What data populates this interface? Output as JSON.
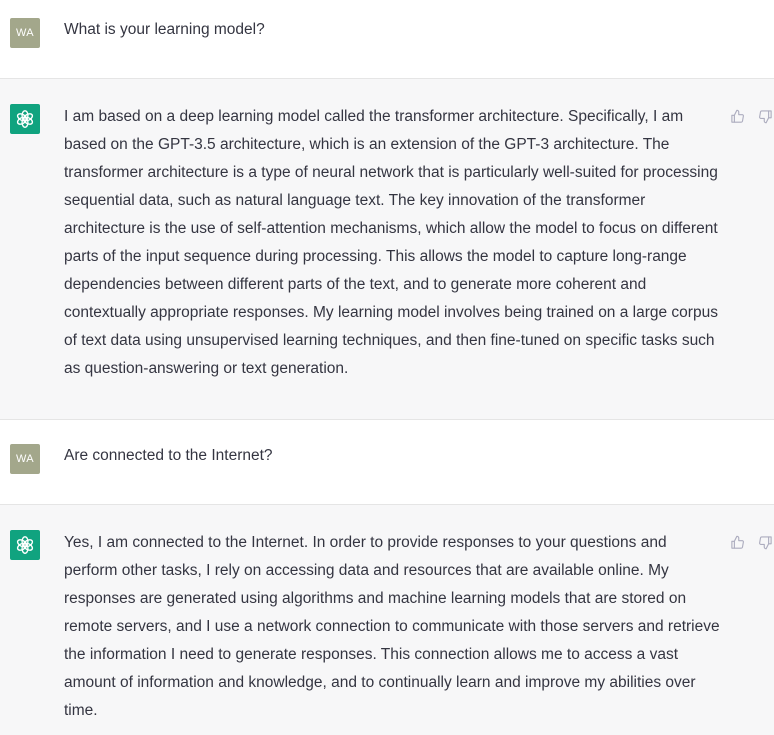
{
  "conversation": {
    "messages": [
      {
        "role": "user",
        "avatar_text": "WA",
        "text": "What is your learning model?"
      },
      {
        "role": "assistant",
        "avatar_icon": "openai-logo-icon",
        "text": "I am based on a deep learning model called the transformer architecture. Specifically, I am based on the GPT-3.5 architecture, which is an extension of the GPT-3 architecture. The transformer architecture is a type of neural network that is particularly well-suited for processing sequential data, such as natural language text. The key innovation of the transformer architecture is the use of self-attention mechanisms, which allow the model to focus on different parts of the input sequence during processing. This allows the model to capture long-range dependencies between different parts of the text, and to generate more coherent and contextually appropriate responses. My learning model involves being trained on a large corpus of text data using unsupervised learning techniques, and then fine-tuned on specific tasks such as question-answering or text generation."
      },
      {
        "role": "user",
        "avatar_text": "WA",
        "text": "Are connected to the Internet?"
      },
      {
        "role": "assistant",
        "avatar_icon": "openai-logo-icon",
        "text": "Yes, I am connected to the Internet. In order to provide responses to your questions and perform other tasks, I rely on accessing data and resources that are available online. My responses are generated using algorithms and machine learning models that are stored on remote servers, and I use a network connection to communicate with those servers and retrieve the information I need to generate responses. This connection allows me to access a vast amount of information and knowledge, and to continually learn and improve my abilities over time."
      }
    ]
  },
  "colors": {
    "user_avatar_bg": "#a3a78b",
    "assistant_avatar_bg": "#10a37f",
    "assistant_row_bg": "#f7f7f8",
    "text": "#343541",
    "icon_gray": "#acacbe"
  },
  "icons": {
    "thumbs_up": "thumbs-up-icon",
    "thumbs_down": "thumbs-down-icon"
  }
}
